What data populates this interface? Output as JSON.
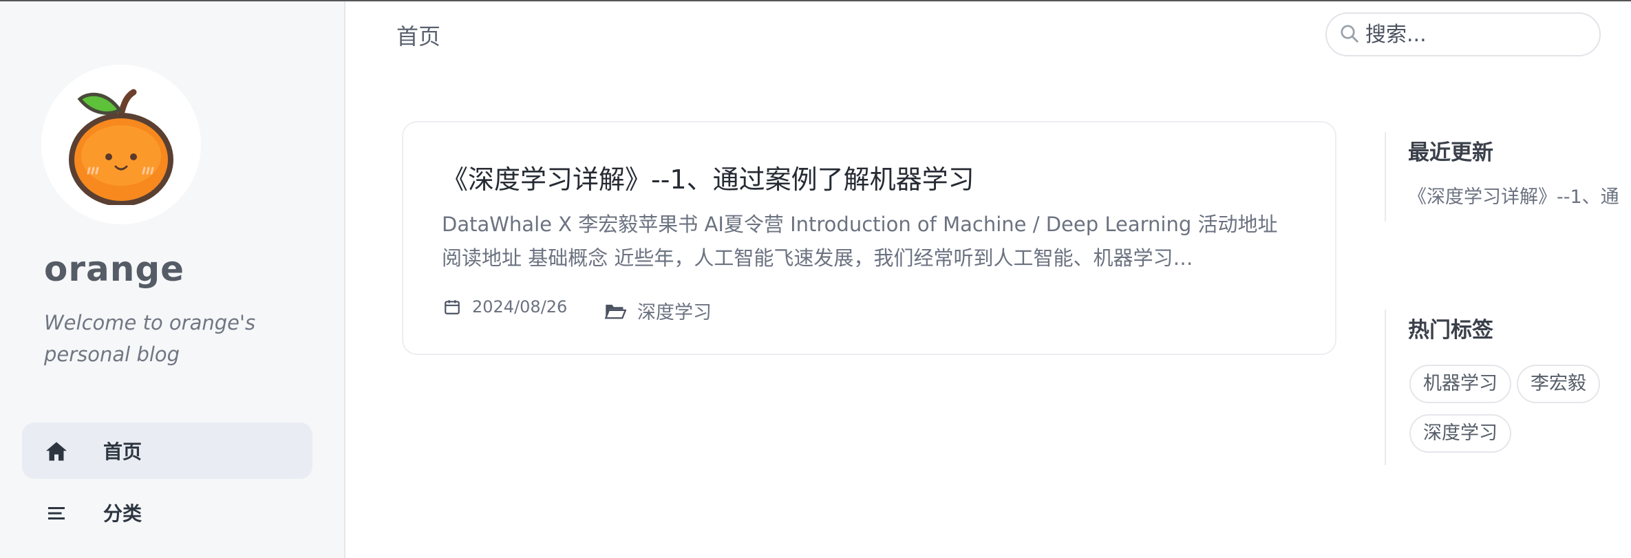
{
  "sidebar": {
    "site_title": "orange",
    "site_subtitle": "Welcome to orange's personal blog",
    "nav": [
      {
        "label": "首页",
        "icon": "home-icon",
        "active": true
      },
      {
        "label": "分类",
        "icon": "menu-lines-icon",
        "active": false
      }
    ]
  },
  "header": {
    "breadcrumb": "首页",
    "search_placeholder": "搜索..."
  },
  "post": {
    "title": "《深度学习详解》--1、通过案例了解机器学习",
    "excerpt": "DataWhale X 李宏毅苹果书 AI夏令营 Introduction of Machine / Deep Learning 活动地址 阅读地址 基础概念 近些年，人工智能飞速发展，我们经常听到人工智能、机器学习…",
    "date": "2024/08/26",
    "category": "深度学习"
  },
  "widgets": {
    "recent_title": "最近更新",
    "recent_items": [
      "《深度学习详解》--1、通"
    ],
    "tags_title": "热门标签",
    "tags": [
      "机器学习",
      "李宏毅",
      "深度学习"
    ]
  },
  "colors": {
    "sidebar_bg": "#f6f7f9",
    "active_nav_bg": "#e9edf3",
    "text": "#34495e"
  }
}
